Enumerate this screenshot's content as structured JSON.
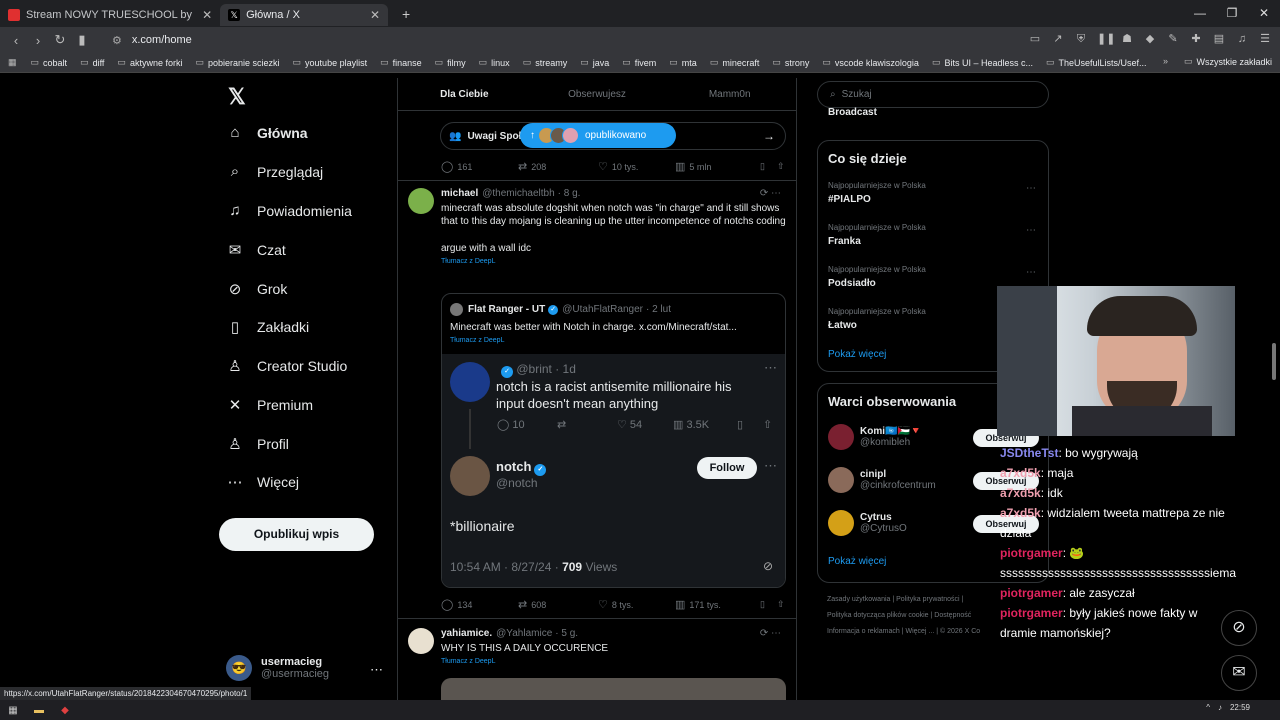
{
  "browser": {
    "tabs": [
      {
        "title": "Stream NOWY TRUESCHOOL by",
        "active": false
      },
      {
        "title": "Główna / X",
        "active": true
      }
    ],
    "url": "x.com/home",
    "bookmarks": [
      "cobalt",
      "diff",
      "aktywne forki",
      "pobieranie sciezki",
      "youtube playlist",
      "finanse",
      "filmy",
      "linux",
      "streamy",
      "java",
      "fivem",
      "mta",
      "minecraft",
      "strony",
      "vscode klawiszologia",
      "Bits UI – Headless c...",
      "TheUsefulLists/Usef..."
    ],
    "bookmarks_right": "Wszystkie zakładki",
    "status_url": "https://x.com/UtahFlatRanger/status/2018422304670470295/photo/1"
  },
  "nav": {
    "items": [
      {
        "label": "Główna",
        "icon": "home-icon",
        "glyph": "⌂"
      },
      {
        "label": "Przeglądaj",
        "icon": "search-icon",
        "glyph": "⌕"
      },
      {
        "label": "Powiadomienia",
        "icon": "bell-icon",
        "glyph": "♫"
      },
      {
        "label": "Czat",
        "icon": "mail-icon",
        "glyph": "✉"
      },
      {
        "label": "Grok",
        "icon": "grok-icon",
        "glyph": "⊘"
      },
      {
        "label": "Zakładki",
        "icon": "bookmark-icon",
        "glyph": "▯"
      },
      {
        "label": "Creator Studio",
        "icon": "creator-icon",
        "glyph": "♙"
      },
      {
        "label": "Premium",
        "icon": "x-premium-icon",
        "glyph": "✕"
      },
      {
        "label": "Profil",
        "icon": "profile-icon",
        "glyph": "♙"
      },
      {
        "label": "Więcej",
        "icon": "more-icon",
        "glyph": "⋯"
      }
    ],
    "post_button": "Opublikuj wpis",
    "account": {
      "name": "usermacieg",
      "handle": "@usermacieg"
    }
  },
  "feed": {
    "tabs": [
      "Dla Ciebie",
      "Obserwujesz",
      "Mamm0n"
    ],
    "notes_label": "Uwagi Społ",
    "published_pill": "opublikowano",
    "first_actions": {
      "replies": "161",
      "reposts": "208",
      "likes": "10 tys.",
      "views": "5 mln"
    },
    "post1": {
      "name": "michael",
      "handle": "@themichaeltbh",
      "time": "· 8 g.",
      "text1": "minecraft was absolute dogshit when notch was \"in charge\" and it still shows that to this day mojang is cleaning up the utter incompetence of notchs coding",
      "text2": "argue with a wall idc",
      "translate": "Tłumacz z DeepL",
      "quote": {
        "name": "Flat Ranger - UT",
        "handle": "@UtahFlatRanger",
        "time": "· 2 lut",
        "text": "Minecraft was better with Notch in charge.  x.com/Minecraft/stat...",
        "translate": "Tłumacz z DeepL",
        "inner1": {
          "handle": "@brint",
          "time": "· 1d",
          "text": "notch is a racist antisemite millionaire his input doesn't mean anything",
          "replies": "10",
          "likes": "54",
          "views": "3.5K"
        },
        "inner2": {
          "name": "notch",
          "handle": "@notch",
          "follow": "Follow",
          "text": "*billionaire",
          "meta": "10:54 AM · 8/27/24 ·",
          "views_num": "709",
          "views_label": "Views"
        }
      },
      "actions": {
        "replies": "134",
        "reposts": "608",
        "likes": "8 tys.",
        "views": "171 tys."
      }
    },
    "post2": {
      "name": "yahiamice.",
      "handle": "@Yahlamice",
      "time": "· 5 g.",
      "text": "WHY IS THIS A DAILY OCCURENCE",
      "translate": "Tłumacz z DeepL"
    }
  },
  "sidebar": {
    "search_placeholder": "Szukaj",
    "broadcast": "Broadcast",
    "trends_title": "Co się dzieje",
    "trends": [
      {
        "context": "Najpopularniejsze w Polska",
        "topic": "#PIALPO"
      },
      {
        "context": "Najpopularniejsze w Polska",
        "topic": "Franka"
      },
      {
        "context": "Najpopularniejsze w Polska",
        "topic": "Podsiadło"
      },
      {
        "context": "Najpopularniejsze w Polska",
        "topic": "Łatwo"
      }
    ],
    "show_more": "Pokaż więcej",
    "follow_title": "Warci obserwowania",
    "follow": [
      {
        "name": "Komi🇺🇳🇵🇸🔻",
        "handle": "@komibleh",
        "button": "Obserwuj",
        "color": "#7a2030"
      },
      {
        "name": "cinipl",
        "handle": "@cinkrofcentrum",
        "button": "Obserwuj",
        "color": "#8a6a5a"
      },
      {
        "name": "Cytrus",
        "handle": "@CytrusO",
        "button": "Obserwuj",
        "color": "#d4a017"
      }
    ],
    "show_more2": "Pokaż więcej",
    "footer": [
      "Zasady użytkowania",
      "Polityka prywatności",
      "Polityka dotycząca plików cookie",
      "Dostępność",
      "Informacja o reklamach",
      "Więcej ...",
      "© 2026 X Co"
    ]
  },
  "chat": [
    {
      "user": "JSDtheTst",
      "msg": ": bo wygrywają"
    },
    {
      "user": "a7xd5k",
      "msg": ": maja"
    },
    {
      "user": "a7xd5k",
      "msg": ": idk"
    },
    {
      "user": "a7xd5k",
      "msg": ": widzialem tweeta mattrepa ze nie działa"
    },
    {
      "user": "piotrgamer",
      "msg": ": 🐸 sssssssssssssssssssssssssssssssssssiema"
    },
    {
      "user": "piotrgamer",
      "msg": ": ale zasyczał"
    },
    {
      "user": "piotrgamer",
      "msg": ": były jakieś nowe fakty w dramie mamońskiej?"
    }
  ],
  "taskbar": {
    "time": "22:59"
  },
  "colors": {
    "accent": "#1d9bf0",
    "bg": "#000000",
    "border": "#2f3336"
  }
}
